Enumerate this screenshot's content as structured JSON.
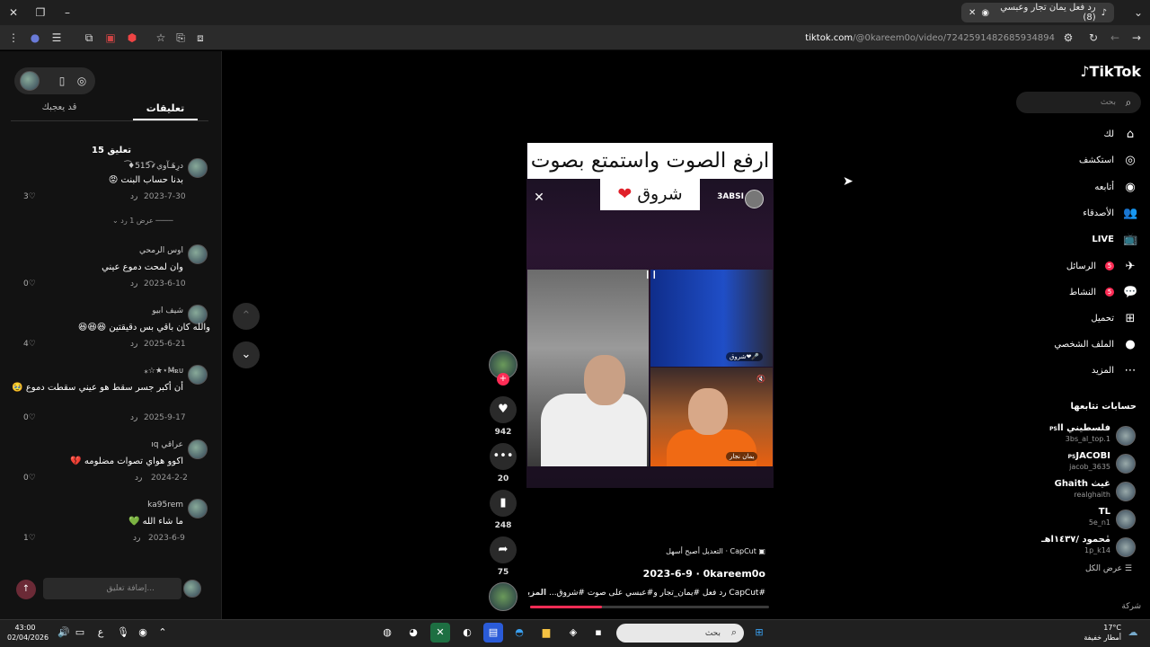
{
  "browser": {
    "tab_title": "رد فعل يمان تجار وعبسي (8)",
    "url_domain": "tiktok.com",
    "url_path": "/@0kareem0o/video/7242591482685934894"
  },
  "comments_panel": {
    "tab_comments": "تعليقات",
    "tab_you_may_like": "قد يعجبك",
    "count_label": "15 تعليق",
    "show_replies": "عرض 1 رد",
    "reply_label": "رد",
    "comments": [
      {
        "name": "درِهَـآوي⸙͡515♦͡",
        "text": "بدنا حساب البنت 😡",
        "date": "2023-7-30",
        "likes": "3"
      },
      {
        "name": "اوس الرمحي",
        "text": "وان لمحت دموع عيني",
        "date": "2023-6-10",
        "likes": "0"
      },
      {
        "name": "شيف ابيو",
        "text": "والله كان باقي بس دقيقتين 😆😆😆",
        "date": "2025-6-21",
        "likes": "4"
      },
      {
        "name": "M̶ꭱᴜ⋆★☆⁎",
        "text": "أن أكبر جسر سقط هو عيني سقطت دموع 🥹",
        "date": "2025-9-17",
        "likes": "0"
      },
      {
        "name": "عراقي ıq",
        "text": "اكوو هواي تصوات مضلومه 💔",
        "date": "2024-2-2",
        "likes": "0"
      },
      {
        "name": "ka95rem",
        "text": "ما شاء الله 💚",
        "date": "2023-6-9",
        "likes": "1"
      }
    ],
    "input_placeholder": "إضافة تعليق..."
  },
  "video": {
    "caption_line1": "ارفع الصوت واستمتع بصوت",
    "caption_line2": "شروق",
    "caption_heart": "❤",
    "live_host": "3ABSI",
    "guest_label_top": "شروق❤🎤",
    "guest_label_bottom": "يمان نجار",
    "likes": "942",
    "comments": "20",
    "saves": "248",
    "shares": "75",
    "capcut_label": "CapCut · التعديل أصبح أسهل",
    "author": "0kareem0o",
    "date": "2023-6-9",
    "description": "#CapCut رد فعل #يمان_تجار و#عبسي على صوت #شروق...",
    "more": "المزيد",
    "progress": 0.3
  },
  "sidebar": {
    "logo": "TikTok",
    "search_placeholder": "بحث",
    "nav": [
      {
        "label": "لك",
        "icon": "home-icon",
        "glyph": "⌂"
      },
      {
        "label": "استكشف",
        "icon": "compass-icon",
        "glyph": "◎"
      },
      {
        "label": "أتابعه",
        "icon": "following-avatar-icon",
        "glyph": "◉"
      },
      {
        "label": "الأصدقاء",
        "icon": "friends-icon",
        "glyph": "👥"
      },
      {
        "label": "LIVE",
        "icon": "live-icon",
        "glyph": "📺"
      },
      {
        "label": "الرسائل",
        "icon": "messages-icon",
        "glyph": "✈",
        "badge": "5"
      },
      {
        "label": "النشاط",
        "icon": "activity-icon",
        "glyph": "💬",
        "badge": "5"
      },
      {
        "label": "تحميل",
        "icon": "upload-icon",
        "glyph": "⊞"
      },
      {
        "label": "الملف الشخصي",
        "icon": "profile-avatar-icon",
        "glyph": "●"
      },
      {
        "label": "المزيد",
        "icon": "more-icon",
        "glyph": "⋯"
      }
    ],
    "following_title": "حسابات تتابعها",
    "following": [
      {
        "name": "فلسطيني اا",
        "tag": "PS",
        "handle": "3bs_al_top.1"
      },
      {
        "name": "JACOBI",
        "tag": "PS",
        "handle": "jacob_3635"
      },
      {
        "name": "Ghaith غيث",
        "tag": "",
        "handle": "realghaith"
      },
      {
        "name": "TL",
        "tag": "",
        "handle": "5e_n1"
      },
      {
        "name": "مٰحمود /١٤٣٧اهـ",
        "tag": "",
        "handle": "1p_k14"
      }
    ],
    "see_all": "عرض الكل",
    "company": "شركة"
  },
  "taskbar": {
    "time": "43:00",
    "date": "02/04/2026",
    "search": "بحث",
    "lang": "ع",
    "temp": "17°C",
    "weather": "أمطار خفيفة"
  },
  "colors": {
    "accent": "#fe2c55",
    "background": "#000000",
    "panel": "#121212"
  }
}
